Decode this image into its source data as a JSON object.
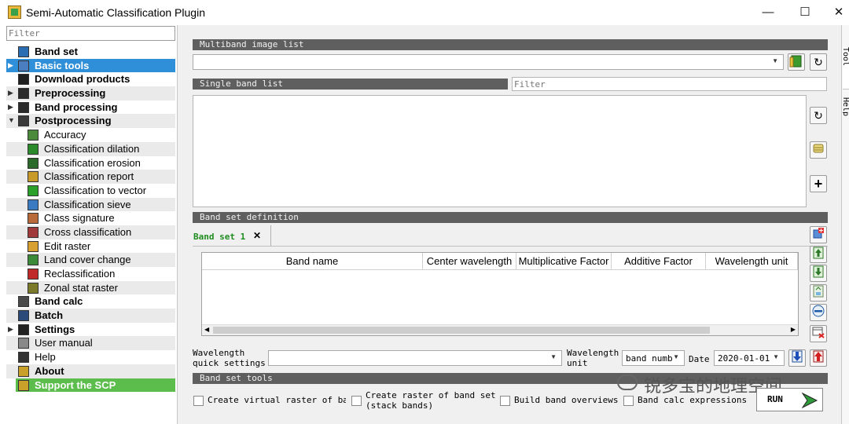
{
  "window": {
    "title": "Semi-Automatic Classification Plugin",
    "minimize": "—",
    "maximize": "☐",
    "close": "✕"
  },
  "sidebar": {
    "filter_placeholder": "Filter",
    "items": [
      {
        "label": "Band set",
        "level": 0,
        "arrow": ""
      },
      {
        "label": "Basic tools",
        "level": 0,
        "arrow": "▶",
        "selected": true
      },
      {
        "label": "Download products",
        "level": 0,
        "arrow": ""
      },
      {
        "label": "Preprocessing",
        "level": 0,
        "arrow": "▶"
      },
      {
        "label": "Band processing",
        "level": 0,
        "arrow": "▶"
      },
      {
        "label": "Postprocessing",
        "level": 0,
        "arrow": "▼"
      },
      {
        "label": "Accuracy",
        "level": 1
      },
      {
        "label": "Classification dilation",
        "level": 1
      },
      {
        "label": "Classification erosion",
        "level": 1
      },
      {
        "label": "Classification report",
        "level": 1
      },
      {
        "label": "Classification to vector",
        "level": 1
      },
      {
        "label": "Classification sieve",
        "level": 1
      },
      {
        "label": "Class signature",
        "level": 1
      },
      {
        "label": "Cross classification",
        "level": 1
      },
      {
        "label": "Edit raster",
        "level": 1
      },
      {
        "label": "Land cover change",
        "level": 1
      },
      {
        "label": "Reclassification",
        "level": 1
      },
      {
        "label": "Zonal stat raster",
        "level": 1
      },
      {
        "label": "Band calc",
        "level": 0,
        "arrow": ""
      },
      {
        "label": "Batch",
        "level": 0,
        "arrow": ""
      },
      {
        "label": "Settings",
        "level": 0,
        "arrow": "▶"
      },
      {
        "label": "User manual",
        "level": 0,
        "arrow": ""
      },
      {
        "label": "Help",
        "level": 0,
        "arrow": ""
      },
      {
        "label": "About",
        "level": 0,
        "arrow": ""
      },
      {
        "label": "Support the SCP",
        "level": 0,
        "arrow": ""
      }
    ]
  },
  "main": {
    "multiband_header": "Multiband image list",
    "single_band_header": "Single band list",
    "single_band_filter_placeholder": "Filter",
    "band_set_definition_header": "Band set definition",
    "band_set_tab": "Band set 1",
    "band_set_tab_close": "✕",
    "table_columns": [
      "Band name",
      "Center wavelength",
      "Multiplicative Factor",
      "Additive Factor",
      "Wavelength unit"
    ],
    "wavelength_quick_label": "Wavelength quick settings",
    "wavelength_unit_label": "Wavelength unit",
    "wavelength_unit_value": "band numb",
    "date_label": "Date",
    "date_value": "2020-01-01",
    "band_set_tools_header": "Band set tools",
    "checkboxes": [
      "Create virtual raster of bar",
      "Create raster of band set (stack bands)",
      "Build band overviews",
      "Band calc expressions"
    ],
    "run_label": "RUN",
    "watermark": "锐多宝的地理空间"
  },
  "right_tabs": [
    "Tool",
    "Help"
  ]
}
